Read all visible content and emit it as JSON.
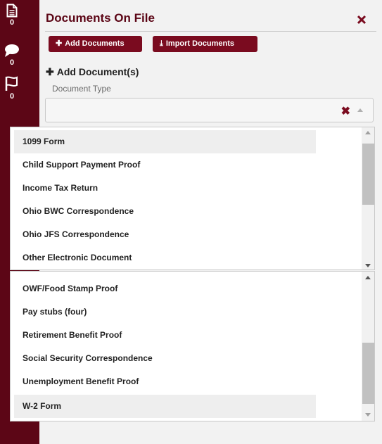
{
  "sidebar": {
    "items": [
      {
        "icon": "document-icon",
        "count": "0"
      },
      {
        "icon": "chat-bubble-icon",
        "count": "0"
      },
      {
        "icon": "flag-icon",
        "count": "0"
      }
    ]
  },
  "panel": {
    "title": "Documents On File",
    "close_icon": "close-icon",
    "buttons": {
      "add_documents": {
        "icon": "plus-icon",
        "label": "Add Documents"
      },
      "import_documents": {
        "icon": "upload-icon",
        "label": "Import Documents"
      }
    },
    "add_heading": "Add Document(s)",
    "document_type_label": "Document Type",
    "select": {
      "value": ""
    }
  },
  "list1": {
    "items": [
      "1099 Form",
      "Child Support Payment Proof",
      "Income Tax Return",
      "Ohio BWC Correspondence",
      "Ohio JFS Correspondence",
      "Other Electronic Document"
    ]
  },
  "list2": {
    "items": [
      "OWF/Food Stamp Proof",
      "Pay stubs (four)",
      "Retirement Benefit Proof",
      "Social Security Correspondence",
      "Unemployment Benefit Proof",
      "W-2 Form"
    ]
  },
  "colors": {
    "sidebar": "#5c0616",
    "accent": "#7a0b1f"
  }
}
